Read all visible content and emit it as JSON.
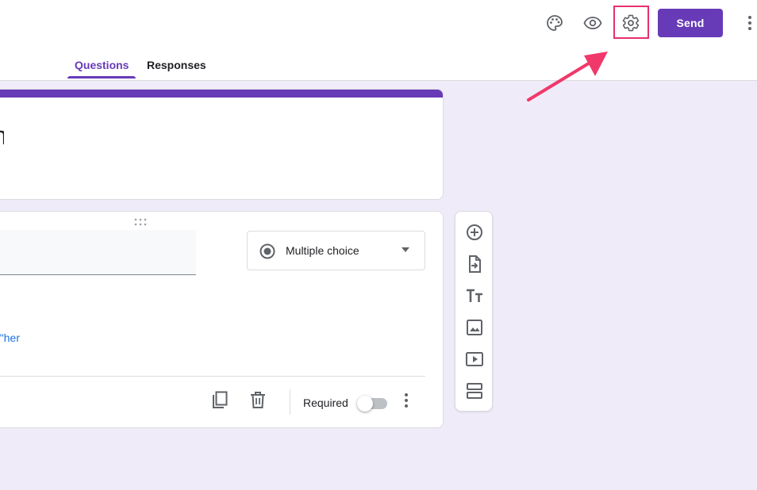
{
  "header": {
    "actions": {
      "customize_theme_icon": "palette-icon",
      "preview_icon": "eye-icon",
      "settings_icon": "gear-icon",
      "send_label": "Send",
      "more_icon": "more-vert-icon"
    },
    "tabs": [
      {
        "label": "Questions",
        "active": true
      },
      {
        "label": "Responses",
        "active": false
      }
    ]
  },
  "form_title": {
    "partial_text": "n"
  },
  "question": {
    "type_label": "Multiple choice",
    "add_other_text": "her\"",
    "required_label": "Required",
    "required_on": false
  },
  "side_toolbar": {
    "tools": [
      "add-question-icon",
      "import-questions-icon",
      "add-title-icon",
      "add-image-icon",
      "add-video-icon",
      "add-section-icon"
    ]
  },
  "colors": {
    "accent": "#673ab7",
    "background": "#f0ebf8",
    "highlight": "#e6316b",
    "link": "#1a73e8"
  }
}
